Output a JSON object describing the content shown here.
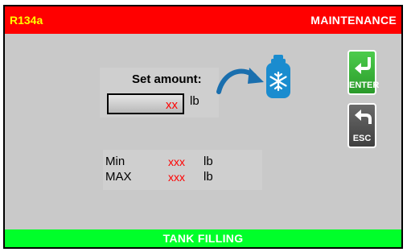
{
  "header": {
    "refrigerant": "R134a",
    "mode": "MAINTENANCE"
  },
  "set_amount": {
    "label": "Set amount:",
    "value": "xx",
    "unit": "lb"
  },
  "range": {
    "min_label": "Min",
    "min_value": "xxx",
    "min_unit": "lb",
    "max_label": "MAX",
    "max_value": "xxx",
    "max_unit": "lb"
  },
  "buttons": {
    "enter_label": "ENTER",
    "esc_label": "ESC"
  },
  "footer": {
    "status": "TANK FILLING"
  },
  "icons": {
    "arrow": "curved-arrow-icon",
    "tank": "refrigerant-tank-icon",
    "enter": "enter-return-icon",
    "esc": "back-arrow-icon"
  },
  "colors": {
    "header_bg": "#ff0000",
    "footer_bg": "#00ff2a",
    "screen_bg": "#c9c9c9",
    "value_red": "#ff0000",
    "enter_green": "#2a9a2a",
    "esc_gray": "#4a4a4a",
    "tank_blue": "#1a8ccf"
  }
}
